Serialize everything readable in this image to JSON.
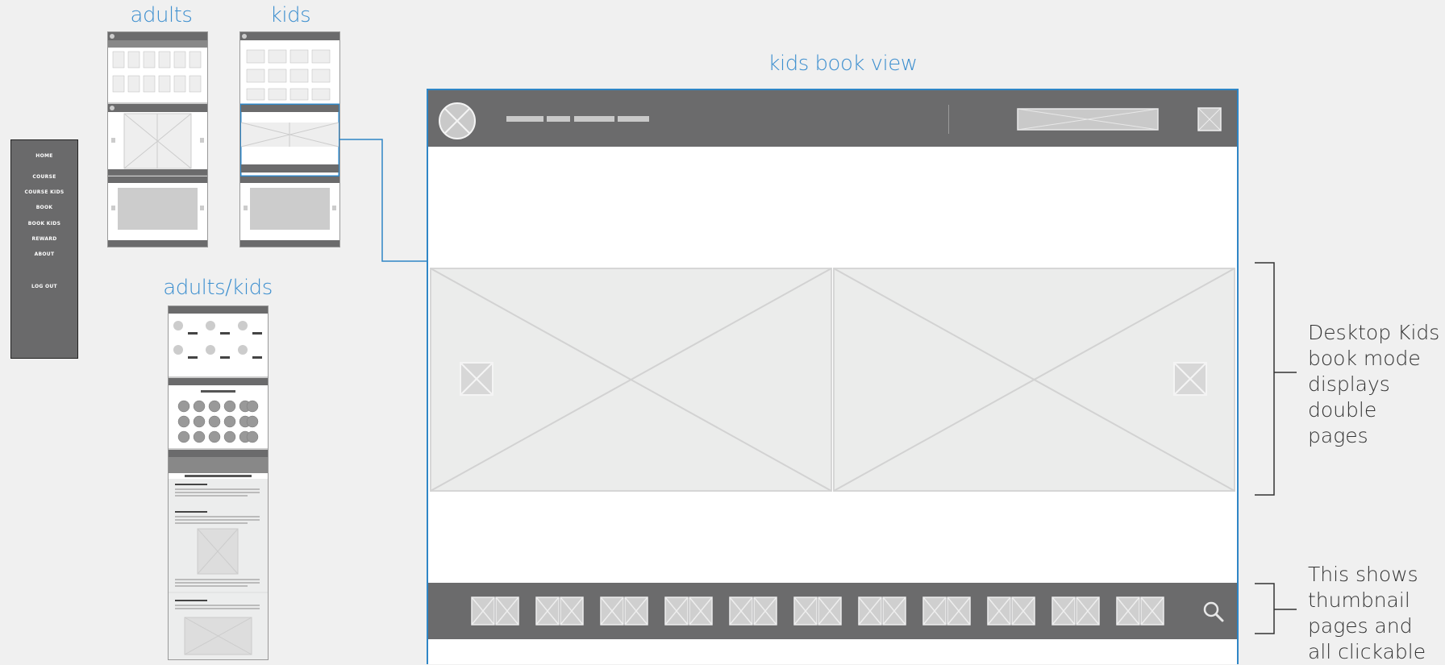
{
  "labels": {
    "adults": "adults",
    "kids": "kids",
    "adults_kids": "adults/kids",
    "kids_book_view": "kids book view"
  },
  "side_menu": {
    "items": [
      "HOME",
      "COURSE",
      "COURSE KIDS",
      "BOOK",
      "BOOK KIDS",
      "REWARD",
      "ABOUT",
      "LOG OUT"
    ]
  },
  "annotations": {
    "book_mode": "Desktop Kids book mode displays double pages",
    "thumbnails": "This shows thumbnail pages and all clickable"
  },
  "colors": {
    "accent_blue": "#2f86c6",
    "header_gray": "#6b6b6c",
    "placeholder_gray": "#e9eaea"
  }
}
